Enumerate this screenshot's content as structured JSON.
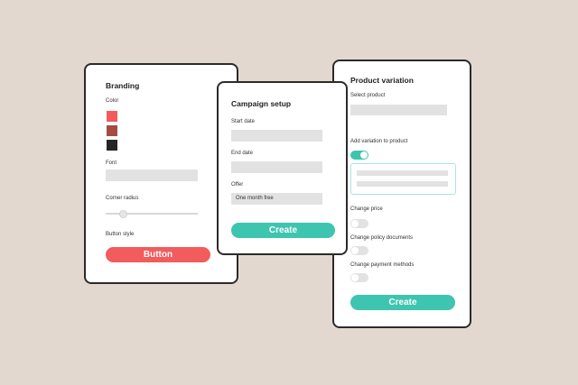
{
  "branding": {
    "title": "Branding",
    "color_label": "Color",
    "swatches": [
      "#f25c5c",
      "#a44c44",
      "#252525"
    ],
    "font_label": "Font",
    "corner_radius_label": "Corner radius",
    "button_style_label": "Button style",
    "button_label": "Button",
    "button_color": "#f25c5c"
  },
  "campaign": {
    "title": "Campaign setup",
    "start_date_label": "Start date",
    "end_date_label": "End date",
    "offer_label": "Offer",
    "offer_value": "One month free",
    "create_label": "Create"
  },
  "product": {
    "title": "Product variation",
    "select_product_label": "Select product",
    "add_variation_label": "Add variation to product",
    "add_variation_on": true,
    "change_price_label": "Change price",
    "change_policy_label": "Change policy documents",
    "change_payment_label": "Change payment methods",
    "create_label": "Create"
  },
  "colors": {
    "accent": "#3ec5b0",
    "primary_red": "#f25c5c"
  }
}
